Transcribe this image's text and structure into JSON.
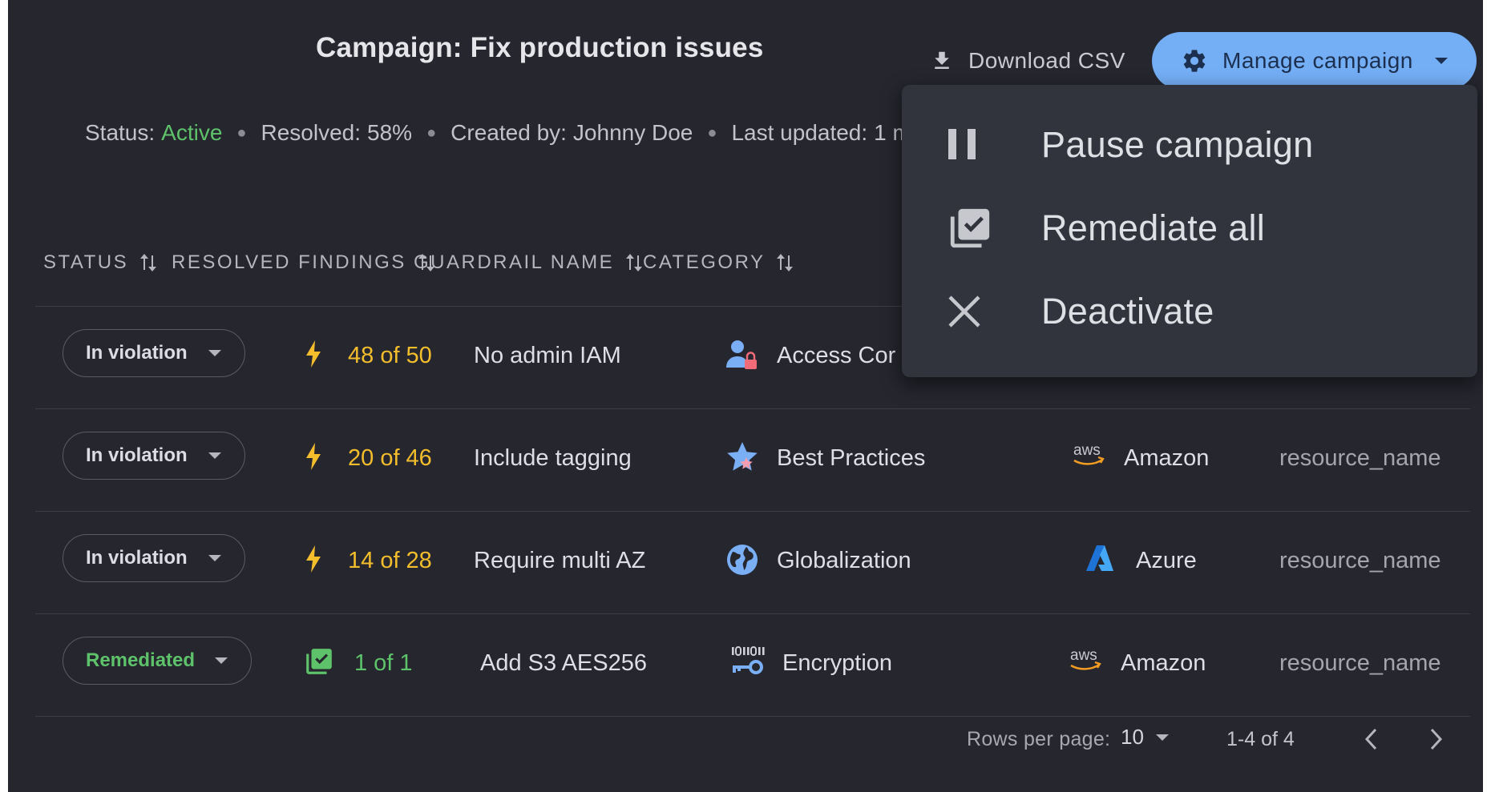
{
  "header": {
    "title": "Campaign: Fix production issues",
    "download_label": "Download CSV",
    "manage_label": "Manage campaign"
  },
  "meta": {
    "status_label": "Status:",
    "status_value": "Active",
    "resolved_label": "Resolved:",
    "resolved_value": "58%",
    "created_label": "Created by:",
    "created_value": "Johnny Doe",
    "updated_label": "Last updated:",
    "updated_value": "1 m"
  },
  "table": {
    "columns": [
      "STATUS",
      "RESOLVED FINDINGS",
      "GUARDRAIL NAME",
      "CATEGORY"
    ],
    "rows": [
      {
        "status": "In violation",
        "findings": "48 of 50",
        "guardrail": "No admin IAM",
        "category": "Access Cor",
        "provider": "",
        "resource": ""
      },
      {
        "status": "In violation",
        "findings": "20 of 46",
        "guardrail": "Include tagging",
        "category": "Best Practices",
        "provider": "Amazon",
        "resource": "resource_name"
      },
      {
        "status": "In violation",
        "findings": "14 of 28",
        "guardrail": "Require multi AZ",
        "category": "Globalization",
        "provider": "Azure",
        "resource": "resource_name"
      },
      {
        "status": "Remediated",
        "findings": "1 of 1",
        "guardrail": "Add S3 AES256",
        "category": "Encryption",
        "provider": "Amazon",
        "resource": "resource_name"
      }
    ]
  },
  "menu": {
    "items": [
      {
        "label": "Pause campaign",
        "icon": "pause-icon"
      },
      {
        "label": "Remediate all",
        "icon": "library-add-check-icon"
      },
      {
        "label": "Deactivate",
        "icon": "close-icon"
      }
    ]
  },
  "footer": {
    "rows_per_page_label": "Rows per page:",
    "rows_per_page_value": "10",
    "range": "1-4 of 4"
  },
  "icons": {
    "aws_text": "aws"
  },
  "colors": {
    "background": "#25262e",
    "accent": "#74aef5",
    "active_green": "#5ec26a",
    "findings_yellow": "#f3bd2c",
    "menu_bg": "#31333d"
  }
}
